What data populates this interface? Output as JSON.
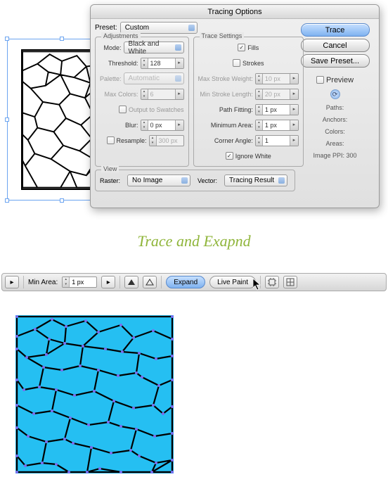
{
  "dialog": {
    "title": "Tracing Options",
    "preset_label": "Preset:",
    "preset_value": "Custom",
    "adjustments": {
      "title": "Adjustments",
      "mode_label": "Mode:",
      "mode_value": "Black and White",
      "threshold_label": "Threshold:",
      "threshold_value": "128",
      "palette_label": "Palette:",
      "palette_value": "Automatic",
      "maxcolors_label": "Max Colors:",
      "maxcolors_value": "6",
      "output_swatches_label": "Output to Swatches",
      "blur_label": "Blur:",
      "blur_value": "0 px",
      "resample_label": "Resample:",
      "resample_value": "300 px"
    },
    "trace_settings": {
      "title": "Trace Settings",
      "fills_label": "Fills",
      "strokes_label": "Strokes",
      "max_stroke_weight_label": "Max Stroke Weight:",
      "max_stroke_weight_value": "10 px",
      "min_stroke_length_label": "Min Stroke Length:",
      "min_stroke_length_value": "20 px",
      "path_fitting_label": "Path Fitting:",
      "path_fitting_value": "1 px",
      "minimum_area_label": "Minimum Area:",
      "minimum_area_value": "1 px",
      "corner_angle_label": "Corner Angle:",
      "corner_angle_value": "1",
      "ignore_white_label": "Ignore White"
    },
    "view": {
      "title": "View",
      "raster_label": "Raster:",
      "raster_value": "No Image",
      "vector_label": "Vector:",
      "vector_value": "Tracing Result"
    },
    "buttons": {
      "trace": "Trace",
      "cancel": "Cancel",
      "save_preset": "Save Preset...",
      "preview": "Preview"
    },
    "stats": {
      "paths": "Paths:",
      "anchors": "Anchors:",
      "colors": "Colors:",
      "areas": "Areas:",
      "image_ppi": "Image PPI: 300"
    }
  },
  "caption": "Trace and Exapnd",
  "toolbar": {
    "min_area_label": "Min Area:",
    "min_area_value": "1 px",
    "expand": "Expand",
    "live_paint": "Live Paint"
  }
}
